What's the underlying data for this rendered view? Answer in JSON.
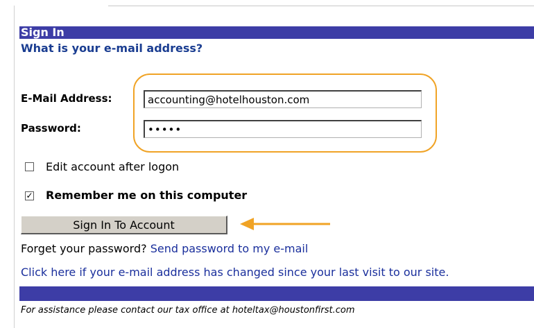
{
  "header": {
    "title": "Sign In"
  },
  "subtitle": "What is your e-mail address?",
  "form": {
    "email_label": "E-Mail Address:",
    "email_value": "accounting@hotelhouston.com",
    "password_label": "Password:",
    "password_value": "•••••",
    "edit_account_label": "Edit account after logon",
    "edit_account_checked": false,
    "remember_label": "Remember me on this computer",
    "remember_checked": true,
    "signin_button": "Sign In To Account"
  },
  "links": {
    "forget_prefix": "Forget your password?",
    "send_password": "Send password to my e-mail",
    "address_changed": "Click here if your e-mail address has changed since your last visit to our site."
  },
  "footer": {
    "assistance": "For assistance please contact our tax office at hoteltax@houstonfirst.com"
  },
  "colors": {
    "header_bar": "#3d3da6",
    "subtitle": "#1a3d91",
    "link": "#1a2f9c",
    "highlight": "#f0a325"
  },
  "icons": {
    "checkmark": "check-icon",
    "annotation_arrow": "arrow-left-icon"
  }
}
